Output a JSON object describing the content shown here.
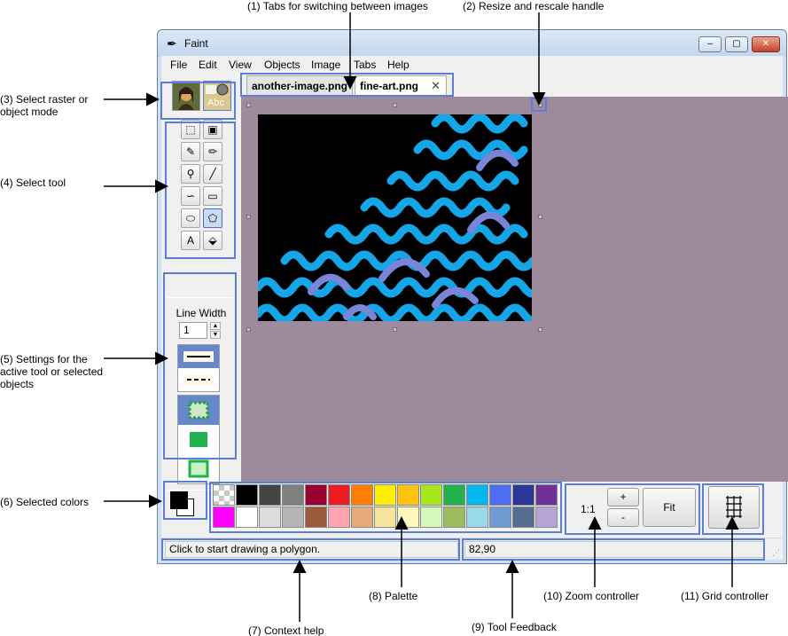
{
  "window": {
    "title": "Faint",
    "minimize": "‒",
    "maximize": "▢",
    "close": "✕"
  },
  "menu": [
    "File",
    "Edit",
    "View",
    "Objects",
    "Image",
    "Tabs",
    "Help"
  ],
  "tabs": [
    {
      "label": "another-image.png"
    },
    {
      "label": "fine-art.png",
      "close": "✕"
    }
  ],
  "toolbox": {
    "mode_object_text": "Abc",
    "line_width_label": "Line Width",
    "line_width_value": "1",
    "spin_up": "▲",
    "spin_down": "▼",
    "tools": [
      {
        "name": "rect-select-tool-icon",
        "glyph": "⬚"
      },
      {
        "name": "object-select-tool-icon",
        "glyph": "▣"
      },
      {
        "name": "pen-tool-icon",
        "glyph": "✎"
      },
      {
        "name": "brush-tool-icon",
        "glyph": "✏"
      },
      {
        "name": "color-picker-tool-icon",
        "glyph": "⚲"
      },
      {
        "name": "line-tool-icon",
        "glyph": "╱"
      },
      {
        "name": "spline-tool-icon",
        "glyph": "∽"
      },
      {
        "name": "rectangle-tool-icon",
        "glyph": "▭"
      },
      {
        "name": "ellipse-tool-icon",
        "glyph": "⬭"
      },
      {
        "name": "polygon-tool-icon",
        "glyph": "⬠"
      },
      {
        "name": "text-tool-icon",
        "glyph": "A"
      },
      {
        "name": "fill-tool-icon",
        "glyph": "⬙"
      }
    ]
  },
  "palette": {
    "row1": [
      "#000000",
      "#444444",
      "#7f7f7f",
      "#990030",
      "#ed1c24",
      "#ff7e00",
      "#ffee00",
      "#ffc20e",
      "#a8e61d",
      "#22b14c",
      "#00b7ef",
      "#4d6df3",
      "#2f3699",
      "#6f3198"
    ],
    "row2": [
      "#ff00ff",
      "#ffffff",
      "#dcdcdc",
      "#b4b4b4",
      "#9c5a3c",
      "#ffa3b1",
      "#e5aa7a",
      "#f5e49c",
      "#fff9bd",
      "#d3f9bc",
      "#9dbb61",
      "#99d9ea",
      "#709ad1",
      "#546d8e",
      "#b5a5d5"
    ]
  },
  "selected_colors": {
    "fg": "#000000",
    "bg": "#ffffff"
  },
  "zoom": {
    "level": "1:1",
    "in": "+",
    "out": "-",
    "fit": "Fit"
  },
  "grid": {
    "glyph": "#"
  },
  "status": {
    "help": "Click to start drawing a polygon.",
    "feedback": "82,90"
  },
  "callouts": {
    "c1": "(1) Tabs for switching between images",
    "c2": "(2)  Resize and rescale handle",
    "c3a": "(3)  Select raster or",
    "c3b": "object mode",
    "c4": "(4)  Select tool",
    "c5a": "(5)  Settings for the",
    "c5b": "active tool or selected",
    "c5c": "objects",
    "c6": "(6)  Selected colors",
    "c7": "(7)  Context help",
    "c8": "(8)  Palette",
    "c9": "(9)  Tool Feedback",
    "c10": "(10) Zoom controller",
    "c11": "(11) Grid controller"
  }
}
